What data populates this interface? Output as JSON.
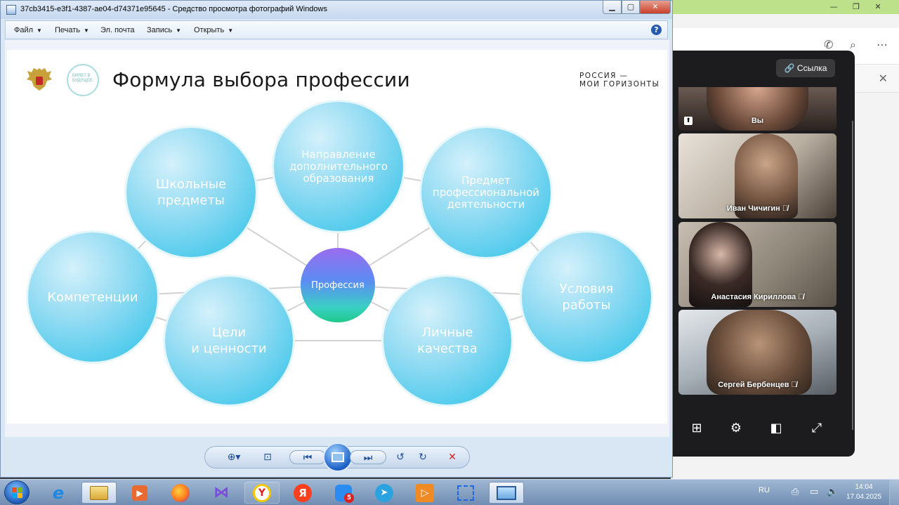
{
  "viewer": {
    "title": "37cb3415-e3f1-4387-ae04-d74371e95645 - Средство просмотра фотографий Windows",
    "menu": [
      {
        "label": "Файл",
        "has_arrow": true
      },
      {
        "label": "Печать",
        "has_arrow": true
      },
      {
        "label": "Эл. почта",
        "has_arrow": false
      },
      {
        "label": "Запись",
        "has_arrow": true
      },
      {
        "label": "Открыть",
        "has_arrow": true
      }
    ],
    "help_label": "?"
  },
  "slide": {
    "title": "Формула выбора профессии",
    "brand_line1": "РОССИЯ —",
    "brand_line2": "МОИ ГОРИЗОНТЫ",
    "logo_text": "БИЛЕТ В БУДУЩЕЕ",
    "center_label": "Профессия",
    "bubbles": [
      {
        "id": "school",
        "lines": [
          "Школьные",
          "предметы"
        ]
      },
      {
        "id": "education",
        "lines": [
          "Направление",
          "дополнительного",
          "образования"
        ]
      },
      {
        "id": "subject",
        "lines": [
          "Предмет",
          "профессиональной",
          "деятельности"
        ]
      },
      {
        "id": "competencies",
        "lines": [
          "Компетенции"
        ]
      },
      {
        "id": "conditions",
        "lines": [
          "Условия",
          "работы"
        ]
      },
      {
        "id": "goals",
        "lines": [
          "Цели",
          "и ценности"
        ]
      },
      {
        "id": "qualities",
        "lines": [
          "Личные",
          "качества"
        ]
      }
    ]
  },
  "call": {
    "link_label": "Ссылка",
    "participants": [
      {
        "name": "Вы",
        "muted": false
      },
      {
        "name": "Иван Чичигин",
        "muted": true
      },
      {
        "name": "Анастасия Кириллова",
        "muted": true
      },
      {
        "name": "Сергей Бербенцев",
        "muted": true
      }
    ]
  },
  "taskbar": {
    "lang": "RU",
    "time": "14:04",
    "date": "17.04.2025",
    "notify_badge": "5",
    "yandex_browser_label": "Y",
    "yandex_label": "Я"
  },
  "colors": {
    "bubble": "#52cbec",
    "center_top": "#9a6cf0",
    "center_bottom": "#20c98a",
    "call_bg": "#1c1c1e"
  }
}
